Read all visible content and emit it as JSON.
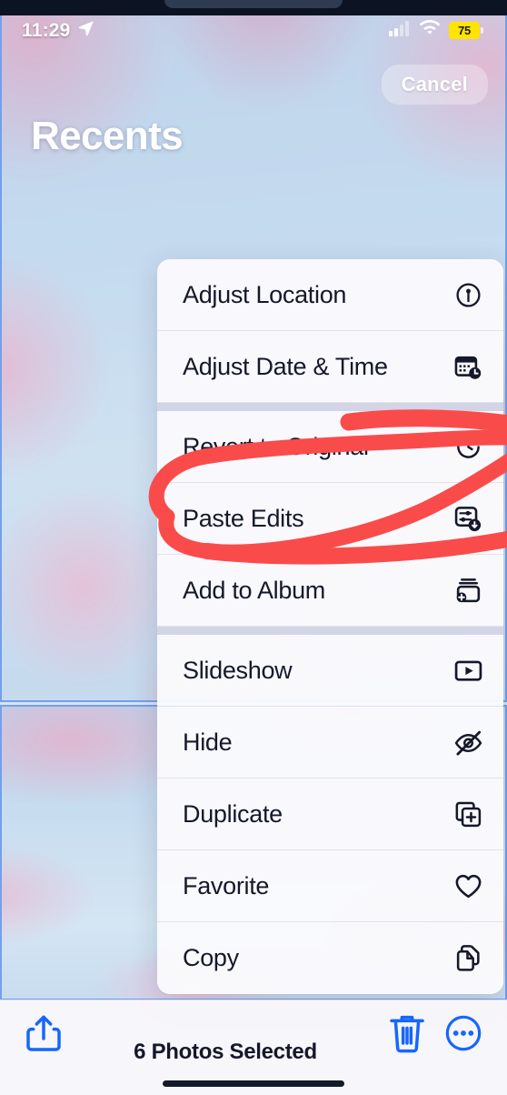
{
  "status_bar": {
    "time": "11:29",
    "location_icon": "location-arrow-icon",
    "cellular_icon": "cellular-bars-icon",
    "wifi_icon": "wifi-icon",
    "battery_percent": "75",
    "battery_color": "#ffe400"
  },
  "nav": {
    "cancel_label": "Cancel",
    "title": "Recents"
  },
  "context_menu": {
    "groups": [
      {
        "items": [
          {
            "label": "Adjust Location",
            "icon": "location-pin-circle-icon"
          },
          {
            "label": "Adjust Date & Time",
            "icon": "calendar-clock-icon"
          }
        ]
      },
      {
        "items": [
          {
            "label": "Revert to Original",
            "icon": "revert-arrow-clock-icon"
          },
          {
            "label": "Paste Edits",
            "icon": "paste-edits-sliders-icon"
          },
          {
            "label": "Add to Album",
            "icon": "album-stack-plus-icon"
          }
        ]
      },
      {
        "items": [
          {
            "label": "Slideshow",
            "icon": "play-rectangle-icon"
          },
          {
            "label": "Hide",
            "icon": "eye-slash-icon"
          },
          {
            "label": "Duplicate",
            "icon": "duplicate-squares-plus-icon"
          },
          {
            "label": "Favorite",
            "icon": "heart-icon"
          },
          {
            "label": "Copy",
            "icon": "copy-documents-icon"
          }
        ]
      }
    ]
  },
  "annotation": {
    "shape": "red-ellipse-highlight",
    "target_item": "Paste Edits",
    "color": "#fa4b4b"
  },
  "toolbar": {
    "share_icon": "share-up-arrow-icon",
    "selection_text": "6 Photos Selected",
    "delete_icon": "trash-icon",
    "more_icon": "ellipsis-circle-icon",
    "accent_color": "#1666ff"
  }
}
